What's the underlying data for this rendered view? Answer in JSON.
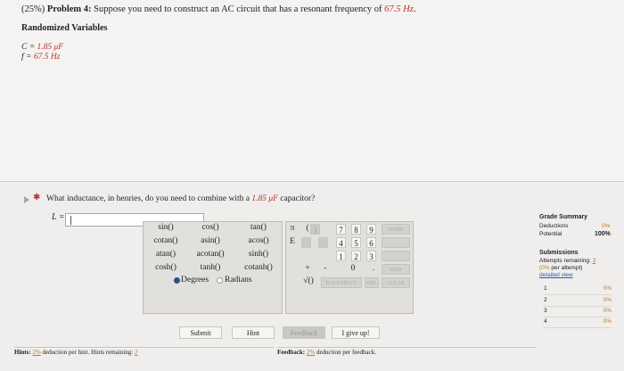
{
  "problem": {
    "percent": "(25%)",
    "label": "Problem 4:",
    "text": "Suppose you need to construct an AC circuit that has a resonant frequency of",
    "freq_value": "67.5 Hz",
    "period": "."
  },
  "randomized": {
    "heading": "Randomized Variables",
    "c_label": "C =",
    "c_value": "1.85 μF",
    "f_label": "f =",
    "f_value": "67.5 Hz"
  },
  "question": {
    "text": "What inductance, in henries, do you need to combine with a",
    "cap_value": "1.85 μF",
    "end": "capacitor?",
    "answer_label": "L =",
    "answer_value": ""
  },
  "calculator": {
    "functions": [
      [
        "sin()",
        "cos()",
        "tan()"
      ],
      [
        "cotan()",
        "asin()",
        "acos()"
      ],
      [
        "atan()",
        "acotan()",
        "sinh()"
      ],
      [
        "cosh()",
        "tanh()",
        "cotanh()"
      ]
    ],
    "degrees": "Degrees",
    "radians": "Radians",
    "pi": "π",
    "open_paren": "(",
    "close_paren": ")",
    "e": "E",
    "digits": [
      "7",
      "8",
      "9",
      "4",
      "5",
      "6",
      "1",
      "2",
      "3",
      "0",
      "."
    ],
    "plus": "+",
    "minus": "-",
    "sqrt": "√()",
    "home": "HOME",
    "end": "END",
    "backspace": "BACKSPACE",
    "del": "DEL",
    "clear": "CLEAR"
  },
  "buttons": {
    "submit": "Submit",
    "hint": "Hint",
    "feedback": "Feedback",
    "give_up": "I give up!"
  },
  "hints": {
    "label": "Hints:",
    "pct": "2%",
    "text": "deduction per hint. Hints remaining:",
    "remaining": "2"
  },
  "feedback": {
    "label": "Feedback:",
    "pct": "2%",
    "text": "deduction per feedback."
  },
  "grade_summary": {
    "title": "Grade Summary",
    "deductions_label": "Deductions",
    "deductions_value": "0%",
    "potential_label": "Potential",
    "potential_value": "100%"
  },
  "submissions": {
    "title": "Submissions",
    "attempts_text": "Attempts remaining:",
    "attempts_value": "3",
    "per_attempt_pct": "(0%",
    "per_attempt_text": "per attempt)",
    "detailed_view": "detailed view",
    "rows": [
      {
        "n": "1",
        "p": "0%"
      },
      {
        "n": "2",
        "p": "0%"
      },
      {
        "n": "3",
        "p": "0%"
      },
      {
        "n": "4",
        "p": "0%"
      }
    ]
  },
  "colors": {
    "accent_red": "#b3332c",
    "orange": "#c37a1e",
    "link_blue": "#2f5aa8"
  }
}
